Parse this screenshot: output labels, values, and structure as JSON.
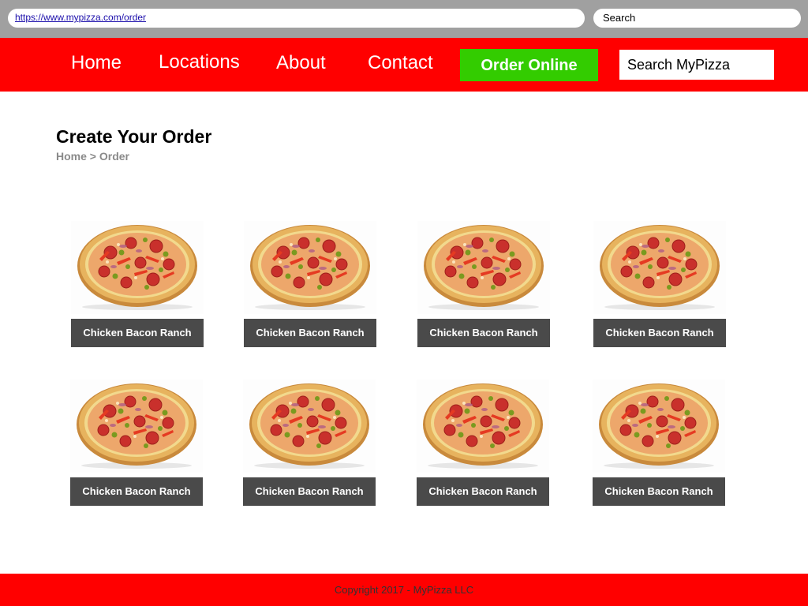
{
  "browser": {
    "url": "https://www.mypizza.com/order",
    "search_label": "Search"
  },
  "nav": {
    "items": [
      {
        "label": "Home"
      },
      {
        "label": "Locations"
      },
      {
        "label": "About"
      },
      {
        "label": "Contact"
      }
    ],
    "order_button": "Order Online",
    "search_placeholder": "Search MyPizza"
  },
  "main": {
    "title": "Create Your Order",
    "breadcrumb": {
      "items": [
        "Home",
        "Order"
      ],
      "separator": ">"
    },
    "products": [
      {
        "name": "Chicken Bacon Ranch"
      },
      {
        "name": "Chicken Bacon Ranch"
      },
      {
        "name": "Chicken Bacon Ranch"
      },
      {
        "name": "Chicken Bacon Ranch"
      },
      {
        "name": "Chicken Bacon Ranch"
      },
      {
        "name": "Chicken Bacon Ranch"
      },
      {
        "name": "Chicken Bacon Ranch"
      },
      {
        "name": "Chicken Bacon Ranch"
      }
    ]
  },
  "footer": {
    "copyright": "Copyright 2017 - MyPizza LLC"
  },
  "colors": {
    "brand_red": "#ff0000",
    "order_green": "#33cc00",
    "label_gray": "#4a4a4a",
    "browser_chrome": "#a0a0a0"
  },
  "icons": {
    "product_image": "pizza-icon"
  }
}
